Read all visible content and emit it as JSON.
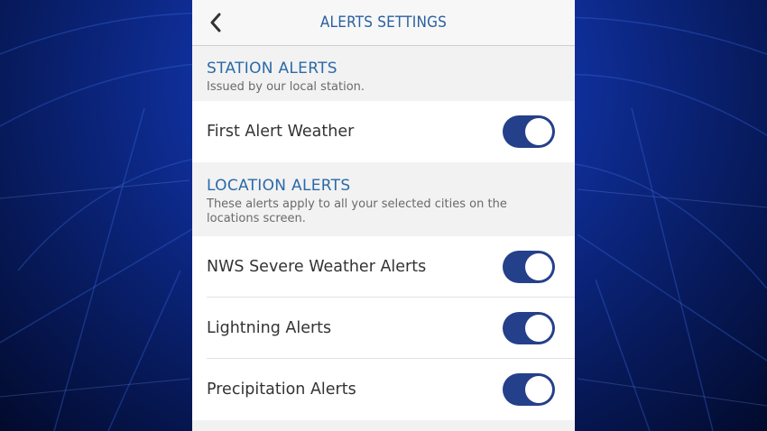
{
  "header": {
    "title": "ALERTS SETTINGS",
    "back_icon": "chevron-left-icon"
  },
  "station_alerts": {
    "title": "STATION ALERTS",
    "subtitle": "Issued by our local station.",
    "items": [
      {
        "label": "First Alert Weather",
        "enabled": true
      }
    ]
  },
  "location_alerts": {
    "title": "LOCATION ALERTS",
    "subtitle": "These alerts apply to all your selected cities on the locations screen.",
    "items": [
      {
        "label": "NWS Severe Weather Alerts",
        "enabled": true
      },
      {
        "label": "Lightning Alerts",
        "enabled": true
      },
      {
        "label": "Precipitation Alerts",
        "enabled": true
      }
    ]
  },
  "colors": {
    "accent": "#2a6aa8",
    "toggle_on": "#25408a",
    "background": "#f2f2f2"
  }
}
